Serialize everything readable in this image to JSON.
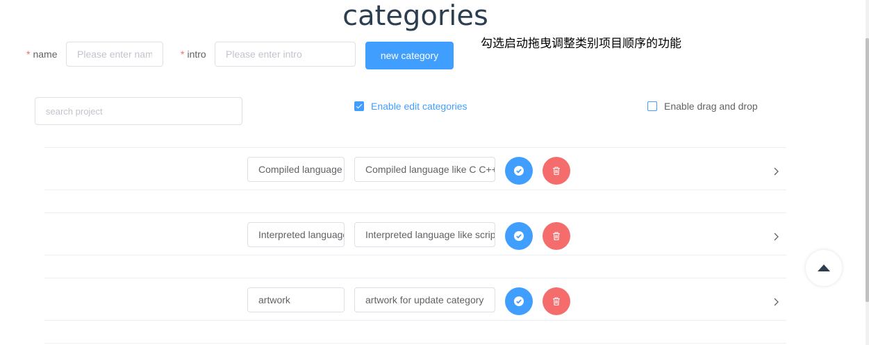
{
  "page": {
    "title": "categories"
  },
  "form": {
    "required_mark": "*",
    "name_label": "name",
    "name_placeholder": "Please enter name",
    "intro_label": "intro",
    "intro_placeholder": "Please enter intro",
    "submit_label": "new category"
  },
  "hint": "勾选启动拖曳调整类别项目顺序的功能",
  "search": {
    "placeholder": "search project"
  },
  "toggles": {
    "edit": {
      "label": "Enable edit categories",
      "checked": true
    },
    "drag": {
      "label": "Enable drag and drop",
      "checked": false
    }
  },
  "categories": [
    {
      "name": "Compiled language",
      "intro": "Compiled language like C C++"
    },
    {
      "name": "Interpreted language",
      "intro": "Interpreted language like script"
    },
    {
      "name": "artwork",
      "intro": "artwork for update category"
    }
  ],
  "icons": {
    "confirm": "check-circle-icon",
    "delete": "trash-icon",
    "expand": "chevron-right-icon",
    "back_to_top": "caret-up-icon"
  },
  "colors": {
    "primary": "#409eff",
    "danger": "#f56c6c",
    "title": "#2c3e50"
  }
}
